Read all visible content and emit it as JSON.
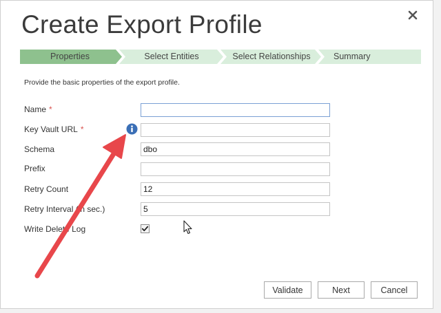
{
  "dialog": {
    "title": "Create Export Profile",
    "close_icon": "close-icon"
  },
  "steps": [
    {
      "label": "Properties",
      "active": true
    },
    {
      "label": "Select Entities",
      "active": false
    },
    {
      "label": "Select Relationships",
      "active": false
    },
    {
      "label": "Summary",
      "active": false
    }
  ],
  "colors": {
    "step_active": "#8ec18e",
    "step_inactive": "#d9eedc",
    "required": "#d9534f",
    "info": "#3b6fb6",
    "arrow": "#e8474b"
  },
  "intro": "Provide the basic properties of the export profile.",
  "form": {
    "name": {
      "label": "Name",
      "required": "*",
      "value": ""
    },
    "key_vault_url": {
      "label": "Key Vault URL",
      "required": "*",
      "value": "",
      "info_icon": "info-icon"
    },
    "schema": {
      "label": "Schema",
      "value": "dbo"
    },
    "prefix": {
      "label": "Prefix",
      "value": ""
    },
    "retry_count": {
      "label": "Retry Count",
      "value": "12"
    },
    "retry_interval": {
      "label": "Retry Interval (in sec.)",
      "value": "5"
    },
    "write_delete_log": {
      "label": "Write Delete Log",
      "checked": true
    }
  },
  "buttons": {
    "validate": "Validate",
    "next": "Next",
    "cancel": "Cancel"
  }
}
